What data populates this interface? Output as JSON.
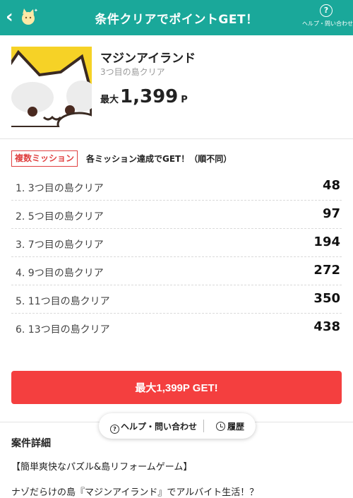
{
  "header": {
    "title": "条件クリアでポイントGET！",
    "help_label": "ヘルプ・問い合わせ",
    "help_glyph": "?",
    "back_glyph": "‹",
    "color": "#1aa89a"
  },
  "app": {
    "name": "マジンアイランド",
    "subtitle": "3つ目の島クリア",
    "reward_prefix": "最大",
    "reward_points": "1,399",
    "reward_unit": "P"
  },
  "missions": {
    "badge": "複数ミッション",
    "note": "各ミッション達成でGET！（順不同）",
    "items": [
      {
        "label": "1. 3つ目の島クリア",
        "points": "48"
      },
      {
        "label": "2. 5つ目の島クリア",
        "points": "97"
      },
      {
        "label": "3. 7つ目の島クリア",
        "points": "194"
      },
      {
        "label": "4. 9つ目の島クリア",
        "points": "272"
      },
      {
        "label": "5. 11つ目の島クリア",
        "points": "350"
      },
      {
        "label": "6. 13つ目の島クリア",
        "points": "438"
      }
    ]
  },
  "cta": {
    "label": "最大1,399P GET!",
    "color": "#f43f3f"
  },
  "float_bar": {
    "help_label": "ヘルプ・問い合わせ",
    "history_label": "履歴"
  },
  "details": {
    "title": "案件詳細",
    "line1": "【簡単爽快なパズル&島リフォームゲーム】",
    "line2": "ナゾだらけの島『マジンアイランド』でアルバイト生活！？"
  }
}
